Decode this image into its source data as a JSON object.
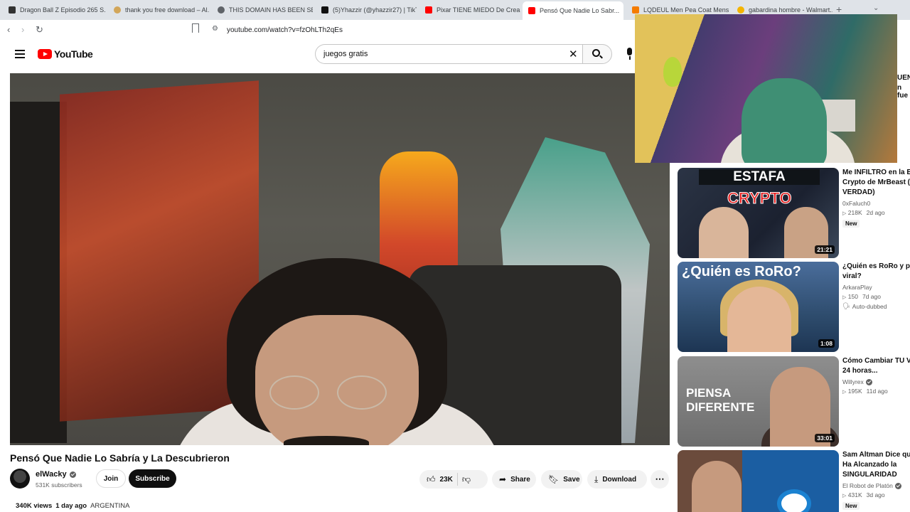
{
  "tabs": [
    {
      "title": "Dragon Ball Z Episodio 265 S...",
      "fav_color": "#333333"
    },
    {
      "title": "thank you free download – Al...",
      "fav_color": "#d2a65a"
    },
    {
      "title": "THIS DOMAIN HAS BEEN SEIZ...",
      "fav_color": "#5f6368"
    },
    {
      "title": "(5)Yhazzir (@yhazzir27) | TikT...",
      "fav_color": "#111111"
    },
    {
      "title": "Pixar TIENE MIEDO De Crear V...",
      "fav_color": "#ff0000"
    },
    {
      "title": "Pensó Que Nadie Lo Sabr...",
      "fav_color": "#ff0000"
    },
    {
      "title": "LQDEUL Men Pea Coat Mens...",
      "fav_color": "#f57c00"
    },
    {
      "title": "gabardina hombre - Walmart...",
      "fav_color": "#f4b400"
    }
  ],
  "browser": {
    "url": "youtube.com/watch?v=fzOhLTh2qEs"
  },
  "header": {
    "logo_text": "YouTube",
    "search_value": "juegos gratis"
  },
  "video": {
    "title": "Pensó Que Nadie Lo Sabría y La Descubrieron",
    "channel": "elWacky",
    "subscribers": "531K subscribers",
    "join_label": "Join",
    "subscribe_label": "Subscribe",
    "likes": "23K",
    "share_label": "Share",
    "save_label": "Save",
    "download_label": "Download",
    "views": "340K views",
    "age": "1 day ago",
    "tag": "ARGENTINA"
  },
  "recommendations": [
    {
      "title_line1": "Me INFILTRO en la Est",
      "title_line2": "Crypto de MrBeast (T",
      "title_line3": "VERDAD)",
      "channel": "0xFaluch0",
      "views": "218K",
      "age": "2d ago",
      "badge": "New",
      "duration": "21:21",
      "thumb_text_1": "ESTAFA",
      "thumb_text_2": "CRYPTO"
    },
    {
      "title_line1": "¿Quién es RoRo y por",
      "title_line2": "viral?",
      "channel": "ArkaraPlay",
      "views": "150",
      "age": "7d ago",
      "badge": "Auto-dubbed",
      "duration": "1:08",
      "thumb_text_1": "¿Quién es RoRo?"
    },
    {
      "title_line1": "Cómo Cambiar TU VID",
      "title_line2": "24 horas...",
      "channel": "Willyrex",
      "views": "195K",
      "age": "11d ago",
      "duration": "33:01",
      "thumb_text_1": "PIENSA",
      "thumb_text_2": "DIFERENTE"
    },
    {
      "title_line1": "Sam Altman Dice que",
      "title_line2": "Ha Alcanzado la",
      "title_line3": "SINGULARIDAD",
      "channel": "El Robot de Platón",
      "views": "431K",
      "age": "3d ago",
      "badge": "New"
    }
  ],
  "overlay_partial_text": {
    "line1": "UEN",
    "line2": "n fue"
  }
}
